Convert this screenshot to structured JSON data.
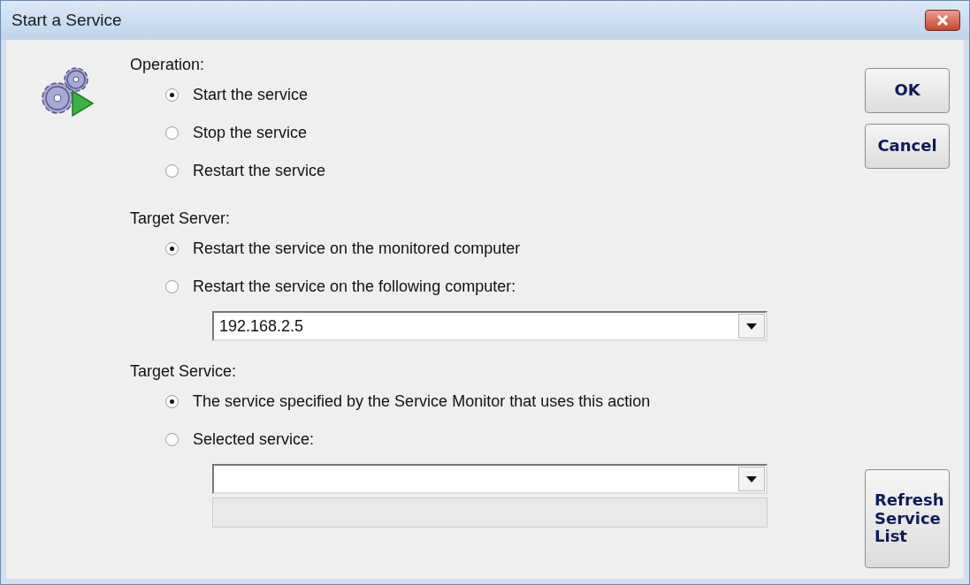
{
  "window": {
    "title": "Start a Service"
  },
  "groups": [
    {
      "label": "Operation:",
      "options": [
        {
          "label": "Start the service",
          "selected": true
        },
        {
          "label": "Stop the service",
          "selected": false
        },
        {
          "label": "Restart the service",
          "selected": false
        }
      ]
    },
    {
      "label": "Target Server:",
      "options": [
        {
          "label": "Restart the service on the monitored computer",
          "selected": true
        },
        {
          "label": "Restart the service on the following computer:",
          "selected": false
        }
      ],
      "dropdown": {
        "value": "192.168.2.5",
        "enabled": true
      }
    },
    {
      "label": "Target Service:",
      "options": [
        {
          "label": "The service specified by the Service Monitor that uses this action",
          "selected": true
        },
        {
          "label": "Selected service:",
          "selected": false
        }
      ],
      "dropdown": {
        "enabled": true
      },
      "info_box": {
        "disabled": true
      }
    }
  ],
  "buttons": [
    {
      "label": "OK",
      "kind": "top"
    },
    {
      "label": "Cancel",
      "kind": "top"
    },
    {
      "label": "Refresh Service List",
      "kind": "bottom"
    }
  ]
}
